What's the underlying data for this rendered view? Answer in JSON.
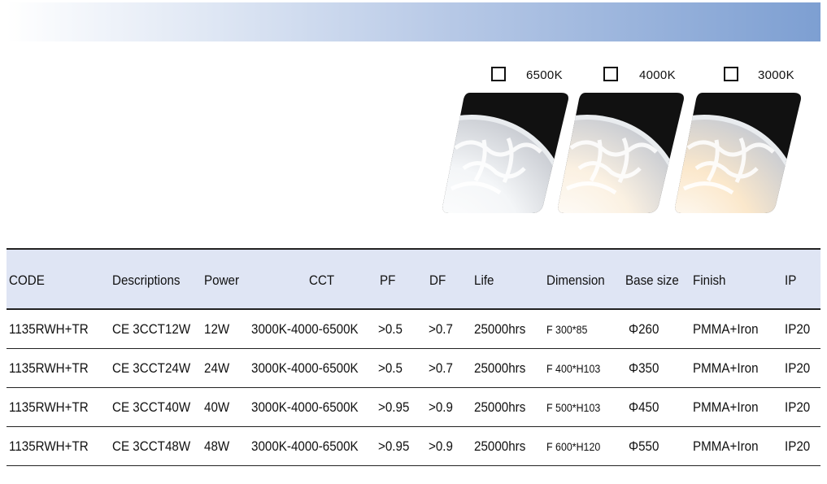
{
  "swatches": [
    {
      "label": "6500K"
    },
    {
      "label": "4000K"
    },
    {
      "label": "3000K"
    }
  ],
  "lamp_colors": [
    "#f4f6f8",
    "#fbf1e2",
    "#fbe8cc"
  ],
  "table": {
    "headers": [
      "CODE",
      "Descriptions",
      "Power",
      "CCT",
      "PF",
      "DF",
      "Life",
      "Dimension",
      "Base size",
      "Finish",
      "IP"
    ],
    "rows": [
      [
        "1135RWH+TR",
        "CE 3CCT12W",
        "12W",
        "3000K-4000-6500K",
        ">0.5",
        ">0.7",
        "25000hrs",
        "F 300*85",
        "Φ260",
        "PMMA+Iron",
        "IP20"
      ],
      [
        "1135RWH+TR",
        "CE 3CCT24W",
        "24W",
        "3000K-4000-6500K",
        ">0.5",
        ">0.7",
        "25000hrs",
        "F 400*H103",
        "Φ350",
        "PMMA+Iron",
        "IP20"
      ],
      [
        "1135RWH+TR",
        "CE 3CCT40W",
        "40W",
        "3000K-4000-6500K",
        ">0.95",
        ">0.9",
        "25000hrs",
        "F 500*H103",
        "Φ450",
        "PMMA+Iron",
        "IP20"
      ],
      [
        "1135RWH+TR",
        "CE 3CCT48W",
        "48W",
        "3000K-4000-6500K",
        ">0.95",
        ">0.9",
        "25000hrs",
        "F 600*H120",
        "Φ550",
        "PMMA+Iron",
        "IP20"
      ]
    ]
  }
}
